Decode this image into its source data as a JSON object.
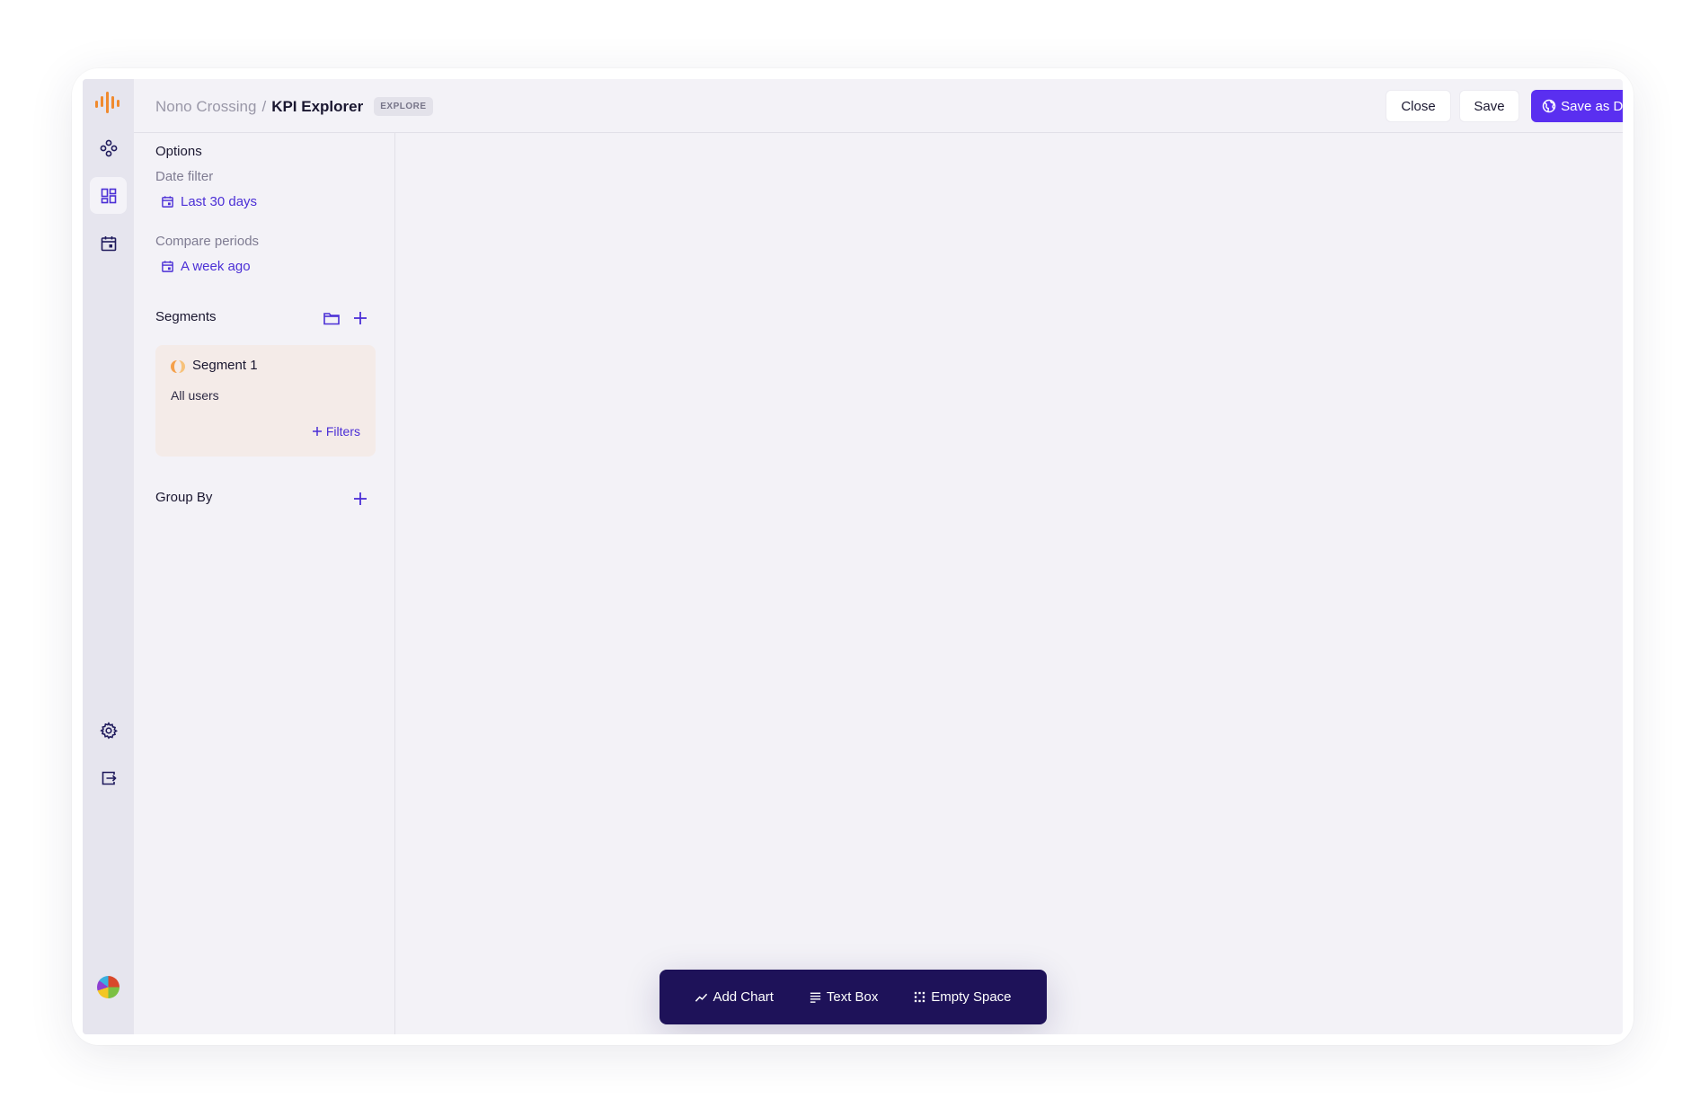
{
  "header": {
    "workspace": "Nono Crossing",
    "separator": "/",
    "page_title": "KPI Explorer",
    "badge": "EXPLORE",
    "close_label": "Close",
    "save_label": "Save",
    "save_dashboard_label": "Save as Dashboard"
  },
  "rail": {
    "items": [
      {
        "icon": "nodes-icon"
      },
      {
        "icon": "dashboard-icon",
        "active": true
      },
      {
        "icon": "calendar-icon"
      }
    ],
    "bottom": [
      {
        "icon": "gear-icon"
      },
      {
        "icon": "logout-icon"
      },
      {
        "icon": "avatar"
      }
    ]
  },
  "options": {
    "title": "Options",
    "date_filter_label": "Date filter",
    "date_filter_value": "Last 30 days",
    "compare_label": "Compare periods",
    "compare_value": "A week ago"
  },
  "segments": {
    "title": "Segments",
    "items": [
      {
        "name": "Segment 1",
        "description": "All users",
        "filters_label": "Filters"
      }
    ]
  },
  "group_by": {
    "title": "Group By"
  },
  "toolbar": {
    "add_chart": "Add Chart",
    "text_box": "Text Box",
    "empty_space": "Empty Space"
  },
  "colors": {
    "accent": "#5a2ff0",
    "toolbar_bg": "#1e1259",
    "segment_bg": "#f4ebe8"
  }
}
